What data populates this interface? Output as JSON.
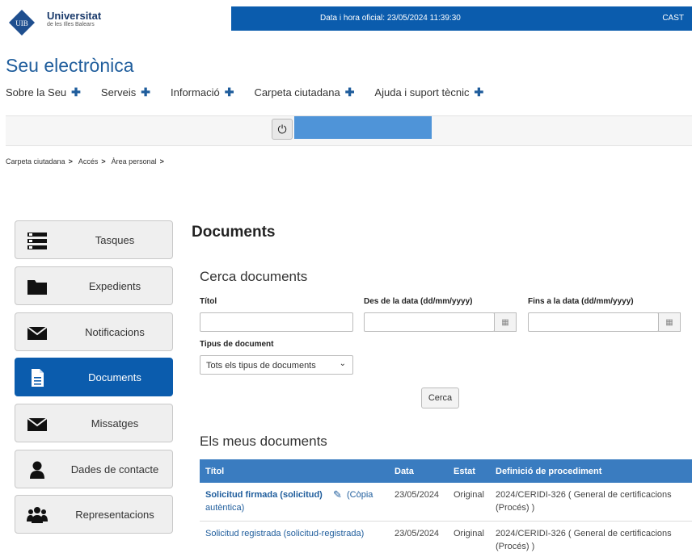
{
  "header": {
    "logo_abbr": "UIB",
    "logo_name": "Universitat",
    "logo_sub": "de les Illes Balears",
    "datetime_label": "Data i hora oficial: 23/05/2024  11:39:30",
    "lang": "CAST"
  },
  "site_title": "Seu electrònica",
  "nav": [
    "Sobre la Seu",
    "Serveis",
    "Informació",
    "Carpeta ciutadana",
    "Ajuda i suport tècnic"
  ],
  "breadcrumb": [
    "Carpeta ciutadana",
    "Accés",
    "Àrea personal"
  ],
  "sidebar": [
    {
      "label": "Tasques",
      "icon": "tasks-icon",
      "active": false
    },
    {
      "label": "Expedients",
      "icon": "folder-icon",
      "active": false
    },
    {
      "label": "Notificacions",
      "icon": "envelope-icon",
      "active": false
    },
    {
      "label": "Documents",
      "icon": "document-icon",
      "active": true
    },
    {
      "label": "Missatges",
      "icon": "envelope-icon",
      "active": false
    },
    {
      "label": "Dades de contacte",
      "icon": "user-icon",
      "active": false
    },
    {
      "label": "Representacions",
      "icon": "users-icon",
      "active": false
    }
  ],
  "main": {
    "title": "Documents",
    "search_title": "Cerca documents",
    "field_title": "Títol",
    "field_from": "Des de la data (dd/mm/yyyy)",
    "field_to": "Fins a la data (dd/mm/yyyy)",
    "field_type": "Tipus de document",
    "type_selected": "Tots els tipus de documents",
    "search_button": "Cerca",
    "mydocs_title": "Els meus documents",
    "table_headers": [
      "Títol",
      "Data",
      "Estat",
      "Definició de procediment"
    ],
    "rows": [
      {
        "title": "Solicitud firmada (solicitud)",
        "extra1": "(Còpia",
        "extra2": "autèntica)",
        "date": "23/05/2024",
        "state": "Original",
        "proc1": "2024/CERIDI-326 ( General de certificacions",
        "proc2": "(Procés) )"
      },
      {
        "title": "Solicitud registrada (solicitud-registrada)",
        "date": "23/05/2024",
        "state": "Original",
        "proc1": "2024/CERIDI-326 ( General de certificacions",
        "proc2": "(Procés) )"
      }
    ]
  }
}
